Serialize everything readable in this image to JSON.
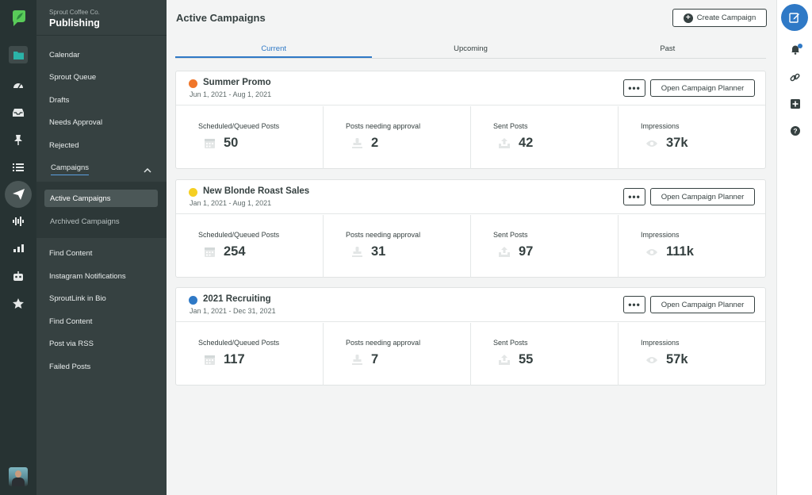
{
  "brand": {
    "org": "Sprout Coffee Co.",
    "section": "Publishing"
  },
  "nav": {
    "items": [
      "Calendar",
      "Sprout Queue",
      "Drafts",
      "Needs Approval",
      "Rejected",
      "Campaigns"
    ],
    "campaigns_sub": [
      "Active Campaigns",
      "Archived Campaigns"
    ],
    "items_after": [
      "Find Content",
      "Instagram Notifications",
      "SproutLink in Bio",
      "Find Content",
      "Post via RSS",
      "Failed Posts"
    ]
  },
  "main": {
    "title": "Active Campaigns",
    "create_button": "Create Campaign",
    "tabs": [
      "Current",
      "Upcoming",
      "Past"
    ],
    "active_tab": "Current"
  },
  "campaigns": [
    {
      "name": "Summer Promo",
      "dates": "Jun 1, 2021 - Aug 1, 2021",
      "color": "#f0762a",
      "more_label": "•••",
      "planner_label": "Open Campaign Planner",
      "stats": [
        {
          "label": "Scheduled/Queued Posts",
          "value": "50",
          "icon": "calendar-icon"
        },
        {
          "label": "Posts needing approval",
          "value": "2",
          "icon": "approval-stamp-icon"
        },
        {
          "label": "Sent Posts",
          "value": "42",
          "icon": "sent-tray-icon"
        },
        {
          "label": "Impressions",
          "value": "37k",
          "icon": "eye-icon"
        }
      ]
    },
    {
      "name": "New Blonde Roast Sales",
      "dates": "Jan 1, 2021 - Aug 1, 2021",
      "color": "#f5cf23",
      "more_label": "•••",
      "planner_label": "Open Campaign Planner",
      "stats": [
        {
          "label": "Scheduled/Queued Posts",
          "value": "254",
          "icon": "calendar-icon"
        },
        {
          "label": "Posts needing approval",
          "value": "31",
          "icon": "approval-stamp-icon"
        },
        {
          "label": "Sent Posts",
          "value": "97",
          "icon": "sent-tray-icon"
        },
        {
          "label": "Impressions",
          "value": "111k",
          "icon": "eye-icon"
        }
      ]
    },
    {
      "name": "2021 Recruiting",
      "dates": "Jan 1, 2021 - Dec 31, 2021",
      "color": "#2f79c6",
      "more_label": "•••",
      "planner_label": "Open Campaign Planner",
      "stats": [
        {
          "label": "Scheduled/Queued Posts",
          "value": "117",
          "icon": "calendar-icon"
        },
        {
          "label": "Posts needing approval",
          "value": "7",
          "icon": "approval-stamp-icon"
        },
        {
          "label": "Sent Posts",
          "value": "55",
          "icon": "sent-tray-icon"
        },
        {
          "label": "Impressions",
          "value": "57k",
          "icon": "eye-icon"
        }
      ]
    }
  ],
  "colors": {
    "rail": "#273333",
    "nav": "#364141",
    "accent": "#2f79c6",
    "brand_green": "#59cb59"
  },
  "rail_icons": [
    "folder-icon",
    "dashboard-gauge-icon",
    "inbox-icon",
    "pin-icon",
    "list-icon",
    "paper-plane-icon",
    "sound-wave-icon",
    "bar-chart-icon",
    "bot-icon",
    "star-icon"
  ],
  "right_rail_icons": [
    "compose-icon",
    "bell-icon",
    "link-icon",
    "add-icon",
    "help-icon"
  ]
}
